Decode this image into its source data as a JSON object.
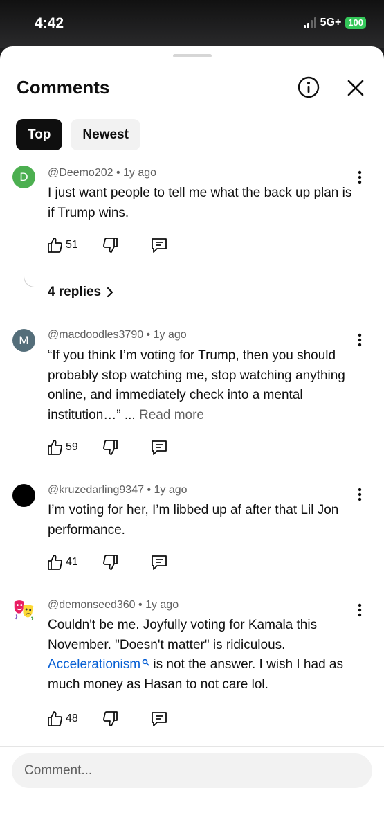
{
  "status_bar": {
    "time": "4:42",
    "network": "5G+",
    "battery": "100"
  },
  "sheet": {
    "title": "Comments"
  },
  "chips": [
    {
      "label": "Top",
      "active": true
    },
    {
      "label": "Newest",
      "active": false
    }
  ],
  "comments": [
    {
      "avatar_letter": "D",
      "avatar_color": "#4caf50",
      "author": "@Deemo202",
      "time": "1y ago",
      "text": "I just want people to tell me what the back up plan is if Trump wins.",
      "likes": "51",
      "replies_label": "4 replies"
    },
    {
      "avatar_letter": "M",
      "avatar_color": "#546e7a",
      "author": "@macdoodles3790",
      "time": "1y ago",
      "text": "“If you think I’m voting for Trump, then you should probably stop watching me, stop watching anything online, and immediately check into a mental institution…” ...",
      "read_more": "Read more",
      "likes": "59"
    },
    {
      "avatar_letter": "",
      "avatar_color": "#000000",
      "author": "@kruzedarling9347",
      "time": "1y ago",
      "text": "I’m voting for her, I’m libbed up af after that Lil Jon performance.",
      "likes": "41"
    },
    {
      "avatar_icon": "theater-masks-icon",
      "author": "@demonseed360",
      "time": "1y ago",
      "text_before": "Couldn't be me. Joyfully voting for Kamala this November. \"Doesn't matter\" is ridiculous.",
      "link": "Accelerationism",
      "text_after": " is not the answer. I wish I had as much money as Hasan to not care lol.",
      "likes": "48"
    }
  ],
  "composer": {
    "placeholder": "Comment..."
  },
  "colors": {
    "accent_link": "#065fd4",
    "chip_active": "#0f0f0f",
    "battery": "#34c759"
  }
}
